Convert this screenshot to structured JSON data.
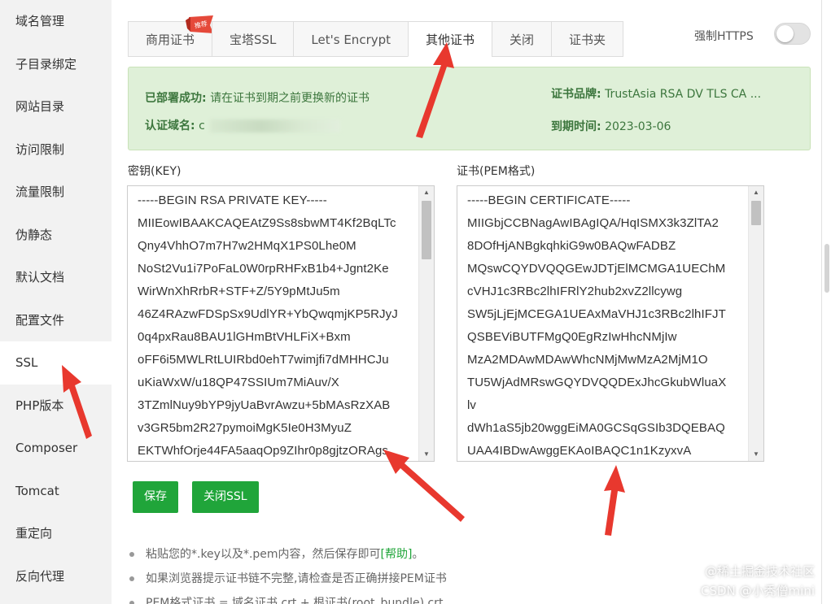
{
  "sidebar": {
    "items": [
      {
        "label": "域名管理"
      },
      {
        "label": "子目录绑定"
      },
      {
        "label": "网站目录"
      },
      {
        "label": "访问限制"
      },
      {
        "label": "流量限制"
      },
      {
        "label": "伪静态"
      },
      {
        "label": "默认文档"
      },
      {
        "label": "配置文件"
      },
      {
        "label": "SSL"
      },
      {
        "label": "PHP版本"
      },
      {
        "label": "Composer"
      },
      {
        "label": "Tomcat"
      },
      {
        "label": "重定向"
      },
      {
        "label": "反向代理"
      }
    ],
    "active": "SSL"
  },
  "tabs": [
    {
      "label": "商用证书",
      "badge": "推荐"
    },
    {
      "label": "宝塔SSL"
    },
    {
      "label": "Let's Encrypt"
    },
    {
      "label": "其他证书",
      "active": true
    },
    {
      "label": "关闭"
    },
    {
      "label": "证书夹"
    }
  ],
  "https_toggle": {
    "label": "强制HTTPS",
    "on": false
  },
  "status": {
    "deployed_label": "已部署成功:",
    "deployed_text": "请在证书到期之前更换新的证书",
    "domain_label": "认证域名:",
    "domain_value": "c",
    "brand_label": "证书品牌:",
    "brand_value": "TrustAsia RSA DV TLS CA ...",
    "expire_label": "到期时间:",
    "expire_value": "2023-03-06"
  },
  "key_box": {
    "label": "密钥(KEY)",
    "lines": [
      "-----BEGIN RSA PRIVATE KEY-----",
      "MIIEowIBAAKCAQEAtZ9Ss8sbwMT4Kf2BqLTc",
      "Qny4VhhO7m7H7w2HMqX1PS0Lhe0M",
      "NoSt2Vu1i7PoFaL0W0rpRHFxB1b4+Jgnt2Ke",
      "WirWnXhRrbR+STF+Z/5Y9pMtJu5m",
      "46Z4RAzwFDSpSx9UdlYR+YbQwqmjKP5RJyJ",
      "0q4pxRau8BAU1lGHmBtVHLFiX+Bxm",
      "oFF6i5MWLRtLUIRbd0ehT7wimjfi7dMHHCJu",
      "uKiaWxW/u18QP47SSIUm7MiAuv/X",
      "3TZmlNuy9bYP9jyUaBvrAwzu+5bMAsRzXAB",
      "v3GR5bm2R27pymoiMgK5Ie0H3MyuZ",
      "EKTWhfOrje44FA5aaqOp9ZIhr0p8gjtzORAgs"
    ],
    "scroll_position": 0.0
  },
  "cert_box": {
    "label": "证书(PEM格式)",
    "lines": [
      "-----BEGIN CERTIFICATE-----",
      "MIIGbjCCBNagAwIBAgIQA/HqISMX3k3ZlTA2",
      "8DOfHjANBgkqhkiG9w0BAQwFADBZ",
      "MQswCQYDVQQGEwJDTjElMCMGA1UEChM",
      "cVHJ1c3RBc2lhIFRlY2hub2xvZ2llcywg",
      "SW5jLjEjMCEGA1UEAxMaVHJ1c3RBc2lhIFJT",
      "QSBEViBUTFMgQ0EgRzIwHhcNMjIw",
      "MzA2MDAwMDAwWhcNMjMwMzA2MjM1O",
      "TU5WjAdMRswGQYDVQQDExJhcGkubWluaX",
      "lv",
      "dWh1aS5jb20wggEiMA0GCSqGSIb3DQEBAQ",
      "UAA4IBDwAwggEKAoIBAQC1n1KzyxvA"
    ],
    "scroll_position": 0.0
  },
  "buttons": {
    "save": "保存",
    "close_ssl": "关闭SSL"
  },
  "tips": {
    "tip1_prefix": "粘贴您的*.key以及*.pem内容，然后保存即可",
    "tip1_link": "[帮助]",
    "tip1_suffix": "。",
    "tip2": "如果浏览器提示证书链不完整,请检查是否正确拼接PEM证书",
    "tip3": "PEM格式证书 = 域名证书.crt + 根证书(root_bundle).crt"
  },
  "watermark": {
    "line1": "@稀土掘金技术社区",
    "line2": "CSDN @小秃僧mini"
  },
  "colors": {
    "primary_green": "#20a53a",
    "alert_bg": "#dff0d8",
    "alert_text": "#3c763d",
    "arrow_red": "#e8382e"
  }
}
